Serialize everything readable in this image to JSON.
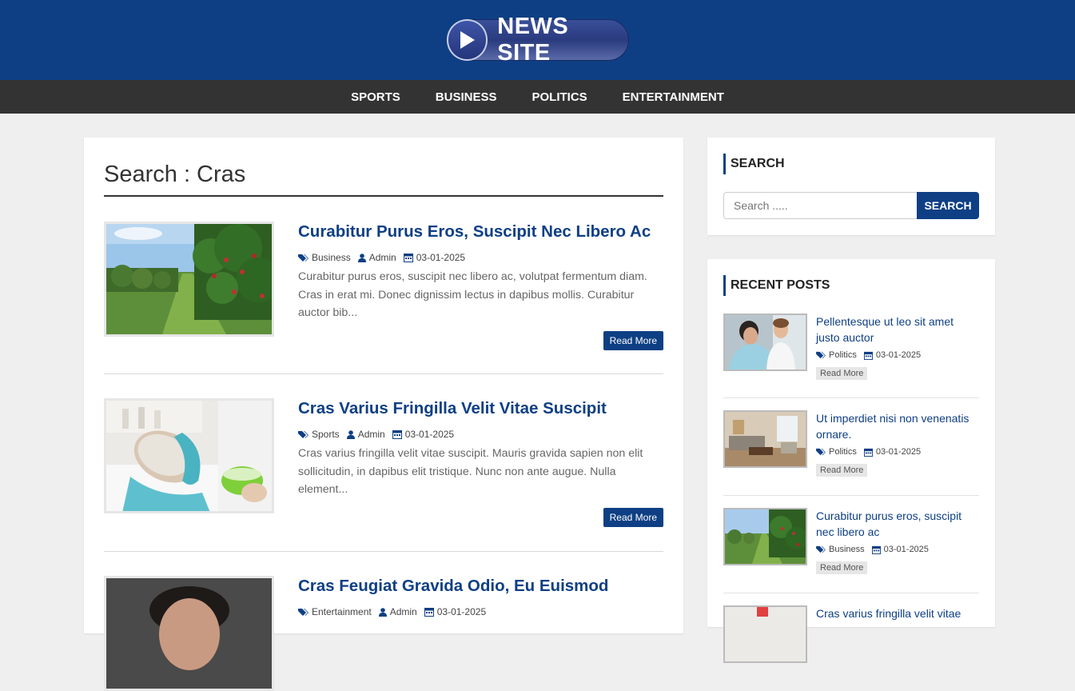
{
  "site": {
    "logo_text": "NEWS SITE"
  },
  "nav": {
    "items": [
      "SPORTS",
      "BUSINESS",
      "POLITICS",
      "ENTERTAINMENT"
    ]
  },
  "main": {
    "search_title": "Search : Cras",
    "posts": [
      {
        "title": "Curabitur Purus Eros, Suscipit Nec Libero Ac",
        "category": "Business",
        "author": "Admin",
        "date": "03-01-2025",
        "excerpt": "Curabitur purus eros, suscipit nec libero ac, volutpat fermentum diam. Cras in erat mi. Donec dignissim lectus in dapibus mollis. Curabitur auctor bib...",
        "read_more": "Read More",
        "thumb": "orchard"
      },
      {
        "title": "Cras Varius Fringilla Velit Vitae Suscipit",
        "category": "Sports",
        "author": "Admin",
        "date": "03-01-2025",
        "excerpt": "Cras varius fringilla velit vitae suscipit. Mauris gravida sapien non elit sollicitudin, in dapibus elit tristique. Nunc non ante augue. Nulla element...",
        "read_more": "Read More",
        "thumb": "spa"
      },
      {
        "title": "Cras Feugiat Gravida Odio, Eu Euismod",
        "category": "Entertainment",
        "author": "Admin",
        "date": "03-01-2025",
        "thumb": "portrait"
      }
    ]
  },
  "sidebar": {
    "search": {
      "heading": "SEARCH",
      "placeholder": "Search .....",
      "button": "SEARCH"
    },
    "recent": {
      "heading": "RECENT POSTS",
      "items": [
        {
          "title": "Pellentesque ut leo sit amet justo auctor",
          "category": "Politics",
          "date": "03-01-2025",
          "read_more": "Read More",
          "thumb": "doctor"
        },
        {
          "title": "Ut imperdiet nisi non venenatis ornare.",
          "category": "Politics",
          "date": "03-01-2025",
          "read_more": "Read More",
          "thumb": "room"
        },
        {
          "title": "Curabitur purus eros, suscipit nec libero ac",
          "category": "Business",
          "date": "03-01-2025",
          "read_more": "Read More",
          "thumb": "orchard"
        },
        {
          "title": "Cras varius fringilla velit vitae",
          "thumb": "spa"
        }
      ]
    }
  },
  "colors": {
    "brand": "#0e3f84",
    "nav_bg": "#333333",
    "page_bg": "#efefef"
  }
}
